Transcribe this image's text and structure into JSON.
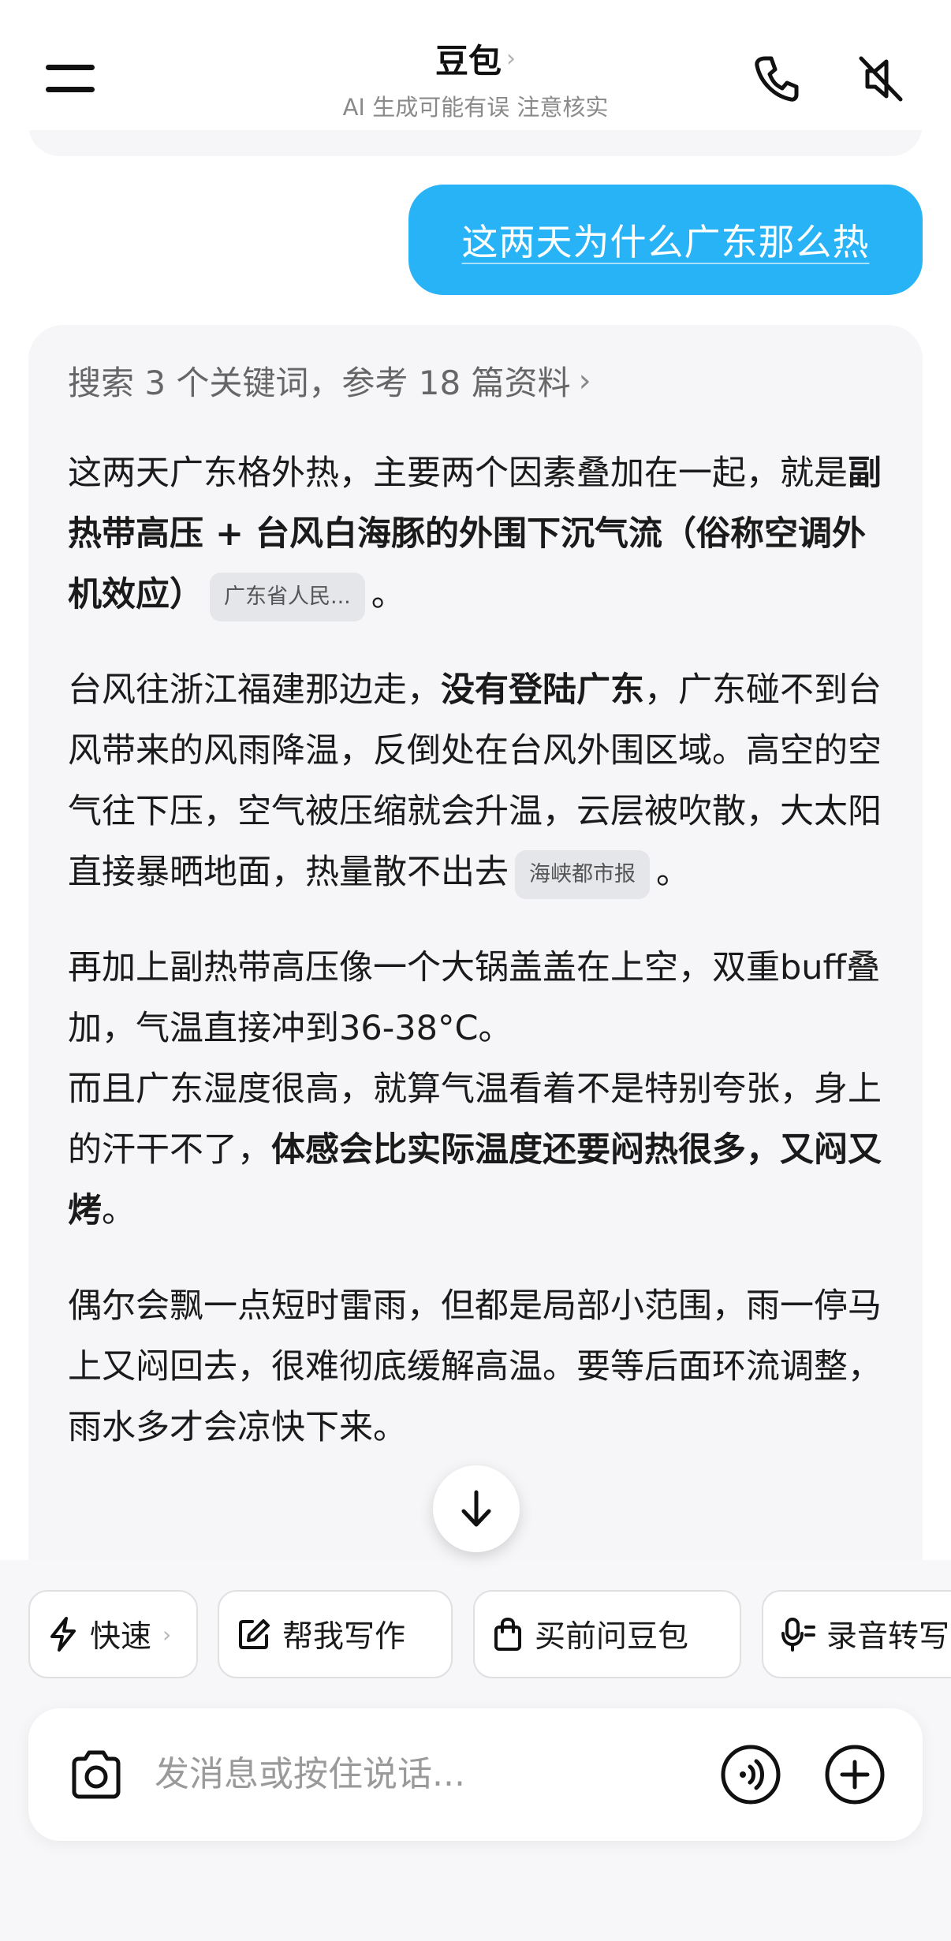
{
  "header": {
    "title": "豆包",
    "subtitle": "AI 生成可能有误 注意核实"
  },
  "user_message": "这两天为什么广东那么热",
  "answer": {
    "search_summary": "搜索 3 个关键词，参考 18 篇资料",
    "p1": {
      "t1": "这两天广东格外热，主要两个因素叠加在一起，就是",
      "b1": "副热带高压 + 台风白海豚的外围下沉气流（俗称空调外机效应）",
      "chip": "广东省人民...",
      "end": "。"
    },
    "p2": {
      "t1": "台风往浙江福建那边走，",
      "b1": "没有登陆广东",
      "t2": "，广东碰不到台风带来的风雨降温，反倒处在台风外围区域。高空的空气往下压，空气被压缩就会升温，云层被吹散，大太阳直接暴晒地面，热量散不出去",
      "chip": "海峡都市报",
      "end": "。"
    },
    "p3": {
      "line1": "再加上副热带高压像一个大锅盖盖在上空，双重buff叠加，气温直接冲到36-38°C。",
      "t1": "而且广东湿度很高，就算气温看着不是特别夸张，身上的汗干不了，",
      "b1": "体感会比实际温度还要闷热很多，又闷又烤",
      "end": "。"
    },
    "p4": "偶尔会飘一点短时雷雨，但都是局部小范围，雨一停马上又闷回去，很难彻底缓解高温。要等后面环流调整，雨水多才会凉快下来。"
  },
  "chips": [
    {
      "label": "快速",
      "icon": "lightning-icon"
    },
    {
      "label": "帮我写作",
      "icon": "edit-icon"
    },
    {
      "label": "买前问豆包",
      "icon": "shopping-bag-icon"
    },
    {
      "label": "录音转写",
      "icon": "mic-icon"
    }
  ],
  "input": {
    "placeholder": "发消息或按住说话..."
  }
}
